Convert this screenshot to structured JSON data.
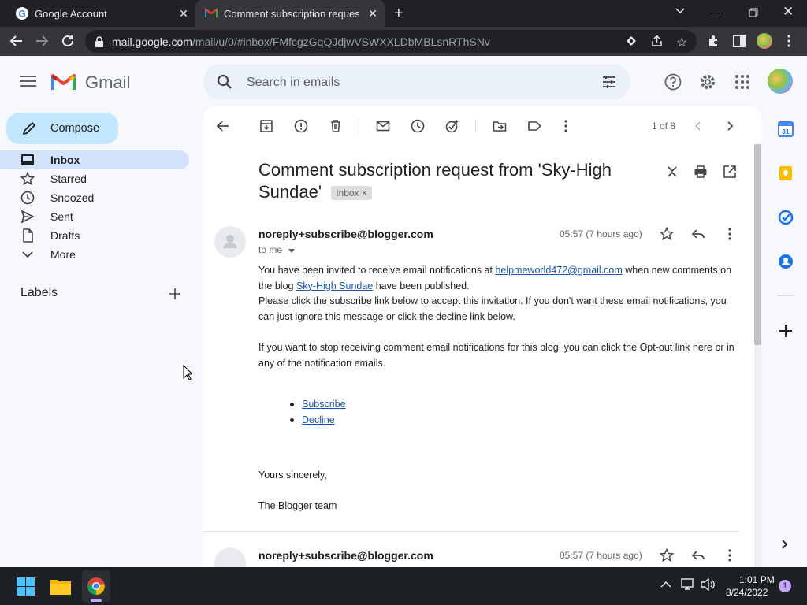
{
  "browser": {
    "tabs": [
      {
        "title": "Google Account"
      },
      {
        "title": "Comment subscription request fr"
      }
    ],
    "url_host": "mail.google.com",
    "url_path": "/mail/u/0/#inbox/FMfcgzGqQJdjwVSWXXLDbMBLsnRThSNv"
  },
  "gmail": {
    "logo_text": "Gmail",
    "compose_label": "Compose",
    "search_placeholder": "Search in emails",
    "nav": [
      {
        "label": "Inbox",
        "icon": "inbox-icon",
        "active": true
      },
      {
        "label": "Starred",
        "icon": "star-icon"
      },
      {
        "label": "Snoozed",
        "icon": "clock-icon"
      },
      {
        "label": "Sent",
        "icon": "send-icon"
      },
      {
        "label": "Drafts",
        "icon": "draft-icon"
      },
      {
        "label": "More",
        "icon": "chevron-down-icon"
      }
    ],
    "labels_heading": "Labels"
  },
  "toolbar": {
    "pager": "1 of 8"
  },
  "email": {
    "subject": "Comment subscription request from 'Sky-High Sundae'",
    "label_chip": "Inbox",
    "label_chip_close": "×",
    "sender": "noreply+subscribe@blogger.com",
    "recipient": "to me",
    "time": "05:57 (7 hours ago)",
    "body": {
      "p1_a": "You have been invited to receive email notifications at ",
      "p1_link": "helpmeworld472@gmail.com",
      "p1_b": " when new comments on the blog ",
      "p1_blog": "Sky-High Sundae",
      "p1_c": " have been published.",
      "p2": "Please click the subscribe link below to accept this invitation. If you don't want these email notifications, you can just ignore this message or click the decline link below.",
      "p3": "If you want to stop receiving comment email notifications for this blog, you can click the Opt-out link here or in any of the notification emails.",
      "links": [
        "Subscribe",
        "Decline"
      ],
      "closing": "Yours sincerely,",
      "signature": "The Blogger team"
    },
    "next_sender": "noreply+subscribe@blogger.com",
    "next_time": "05:57 (7 hours ago)"
  },
  "taskbar": {
    "time": "1:01 PM",
    "date": "8/24/2022",
    "notification_count": "1"
  },
  "colors": {
    "accent_compose": "#c2e7ff",
    "active_nav": "#d3e3fd",
    "link": "#1a55b8"
  }
}
